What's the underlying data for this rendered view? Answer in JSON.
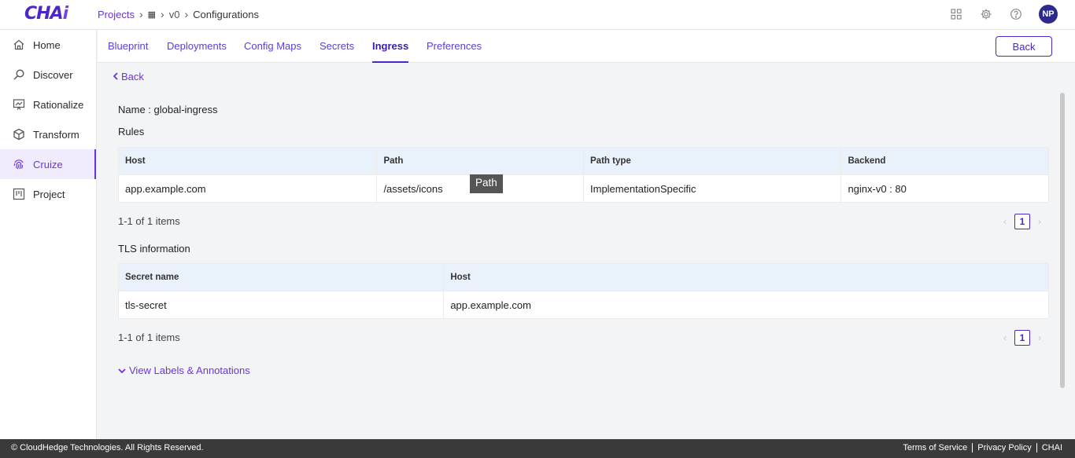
{
  "app": {
    "logo_main": "CHA",
    "logo_accent": "i"
  },
  "breadcrumb": {
    "projects": "Projects",
    "grid_icon": "▦",
    "version": "v0",
    "current": "Configurations"
  },
  "header_icons": [
    "apps-grid-icon",
    "gear-icon",
    "help-icon"
  ],
  "user": {
    "initials": "NP",
    "avatar_color": "#2c2a8c"
  },
  "sidebar": {
    "items": [
      {
        "label": "Home",
        "icon": "home-icon"
      },
      {
        "label": "Discover",
        "icon": "discover-icon"
      },
      {
        "label": "Rationalize",
        "icon": "rationalize-icon"
      },
      {
        "label": "Transform",
        "icon": "cube-icon"
      },
      {
        "label": "Cruize",
        "icon": "fingerprint-icon",
        "active": true
      },
      {
        "label": "Project",
        "icon": "board-icon"
      }
    ]
  },
  "tabs": [
    {
      "label": "Blueprint"
    },
    {
      "label": "Deployments"
    },
    {
      "label": "Config Maps"
    },
    {
      "label": "Secrets"
    },
    {
      "label": "Ingress",
      "active": true
    },
    {
      "label": "Preferences"
    }
  ],
  "back_button": "Back",
  "back_link": "Back",
  "ingress": {
    "name_line": "Name : global-ingress",
    "rules_title": "Rules",
    "rules_columns": [
      "Host",
      "Path",
      "Path type",
      "Backend"
    ],
    "rules_rows": [
      [
        "app.example.com",
        "/assets/icons",
        "ImplementationSpecific",
        "nginx-v0 : 80"
      ]
    ],
    "rules_count": "1-1 of 1 items",
    "tooltip": "Path",
    "tls_title": "TLS information",
    "tls_columns": [
      "Secret name",
      "Host"
    ],
    "tls_rows": [
      [
        "tls-secret",
        "app.example.com"
      ]
    ],
    "tls_count": "1-1 of 1 items",
    "page_number": "1",
    "view_labels": "View Labels & Annotations"
  },
  "footer": {
    "copyright": "© CloudHedge Technologies. All Rights Reserved.",
    "links": [
      "Terms of Service",
      "Privacy Policy",
      "CHAI"
    ]
  },
  "colors": {
    "accent": "#4b27c9",
    "link": "#6b35d9",
    "header_row": "#e9f1fb",
    "footer_bg": "#3a3a3a"
  }
}
